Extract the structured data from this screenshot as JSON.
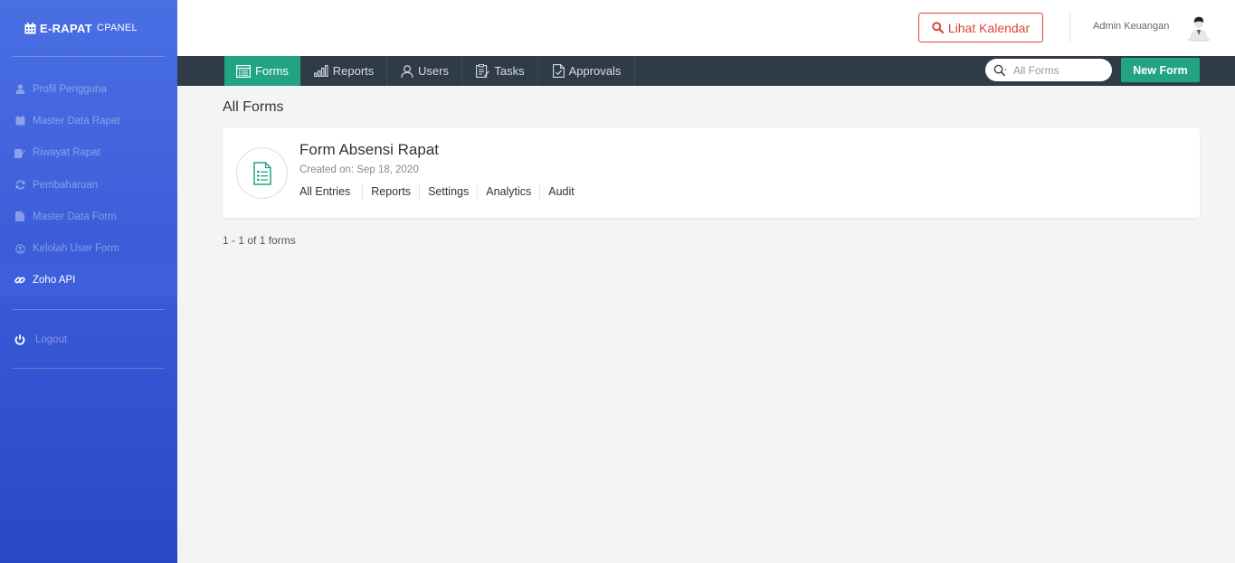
{
  "brand": {
    "name": "E-RAPAT",
    "suffix": "CPANEL"
  },
  "sidebar": {
    "items": [
      {
        "label": "Profil Pengguna",
        "icon": "user-icon"
      },
      {
        "label": "Master Data Rapat",
        "icon": "calendar-icon"
      },
      {
        "label": "Riwayat Rapat",
        "icon": "edit-icon"
      },
      {
        "label": "Pembaharuan",
        "icon": "refresh-icon"
      },
      {
        "label": "Master Data Form",
        "icon": "file-icon"
      },
      {
        "label": "Kelolah User Form",
        "icon": "user-circle-icon"
      },
      {
        "label": "Zoho API",
        "icon": "link-icon",
        "active": true
      }
    ],
    "logout": "Logout"
  },
  "header": {
    "calendar_button": "Lihat Kalendar",
    "user_name": "Admin Keuangan"
  },
  "nav": {
    "tabs": [
      "Forms",
      "Reports",
      "Users",
      "Tasks",
      "Approvals"
    ],
    "active_tab": "Forms",
    "search_placeholder": "All Forms",
    "new_form": "New Form"
  },
  "main": {
    "title": "All Forms",
    "forms": [
      {
        "name": "Form Absensi Rapat",
        "created": "Created on: Sep 18, 2020",
        "links": [
          "All Entries",
          "Reports",
          "Settings",
          "Analytics",
          "Audit"
        ]
      }
    ],
    "pagination": "1 - 1 of 1 forms"
  },
  "colors": {
    "accent": "#22a483",
    "navbar": "#2f3b48",
    "sidebar": "#3a5ad8",
    "calendar_button": "#d9453c"
  }
}
